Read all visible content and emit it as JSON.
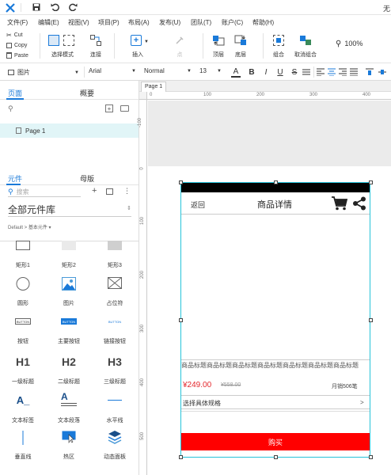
{
  "title_bar": {
    "title_partial": "无"
  },
  "menu": [
    "文件(F)",
    "编辑(E)",
    "视图(V)",
    "项目(P)",
    "布局(A)",
    "发布(U)",
    "团队(T)",
    "账户(C)",
    "帮助(H)"
  ],
  "clipboard": {
    "cut": "Cut",
    "copy": "Copy",
    "paste": "Paste"
  },
  "toolbar": {
    "select_mode": "选择模式",
    "connect": "连接",
    "insert": "插入",
    "point": "点",
    "top": "顶层",
    "bottom": "底层",
    "group": "组合",
    "ungroup": "取消组合",
    "zoom": "100%"
  },
  "format": {
    "element_type": "图片",
    "font": "Arial",
    "style": "Normal",
    "size": "13"
  },
  "pages_panel": {
    "tab_pages": "页面",
    "tab_outline": "概要",
    "page1": "Page 1"
  },
  "library_panel": {
    "tab_widgets": "元件",
    "tab_masters": "母版",
    "search_placeholder": "搜索",
    "library_name": "全部元件库",
    "breadcrumb": "Default > 基本元件 ▾",
    "items": [
      {
        "label": "矩形1",
        "icon": "rect1-icon"
      },
      {
        "label": "矩形2",
        "icon": "rect2-icon"
      },
      {
        "label": "矩形3",
        "icon": "rect3-icon"
      },
      {
        "label": "圆形",
        "icon": "circle-icon"
      },
      {
        "label": "图片",
        "icon": "image-icon"
      },
      {
        "label": "占位符",
        "icon": "placeholder-icon"
      },
      {
        "label": "按钮",
        "icon": "button-icon",
        "inner": "BUTTON"
      },
      {
        "label": "主要按钮",
        "icon": "primary-button-icon",
        "inner": "BUTTON"
      },
      {
        "label": "链接按钮",
        "icon": "link-button-icon",
        "inner": "BUTTON"
      },
      {
        "label": "一级标题",
        "icon": "h1-icon",
        "inner": "H1"
      },
      {
        "label": "二级标题",
        "icon": "h2-icon",
        "inner": "H2"
      },
      {
        "label": "三级标题",
        "icon": "h3-icon",
        "inner": "H3"
      },
      {
        "label": "文本标签",
        "icon": "text-label-icon",
        "inner": "A_"
      },
      {
        "label": "文本段落",
        "icon": "paragraph-icon",
        "inner": "A"
      },
      {
        "label": "水平线",
        "icon": "hline-icon"
      },
      {
        "label": "垂直线",
        "icon": "vline-icon"
      },
      {
        "label": "热区",
        "icon": "hotspot-icon"
      },
      {
        "label": "动态面板",
        "icon": "dynamic-panel-icon"
      }
    ]
  },
  "canvas_tab": "Page 1",
  "ruler": {
    "h": [
      "0",
      "100",
      "200",
      "300",
      "400"
    ],
    "v": [
      "-100",
      "0",
      "100",
      "200",
      "300",
      "400",
      "500"
    ]
  },
  "mockup": {
    "back": "返回",
    "title": "商品详情",
    "product_title": "商品标题商品标题商品标题商品标题商品标题商品标题商品标题",
    "price": "¥249.00",
    "old_price": "¥558.00",
    "sales": "月销506笔",
    "spec": "选择具体规格",
    "spec_arrow": ">",
    "buy": "购买"
  },
  "colors": {
    "accent": "#1a7ad9",
    "buy_red": "#ff0000",
    "price_red": "#e4262b",
    "selection": "#25c3d9"
  }
}
